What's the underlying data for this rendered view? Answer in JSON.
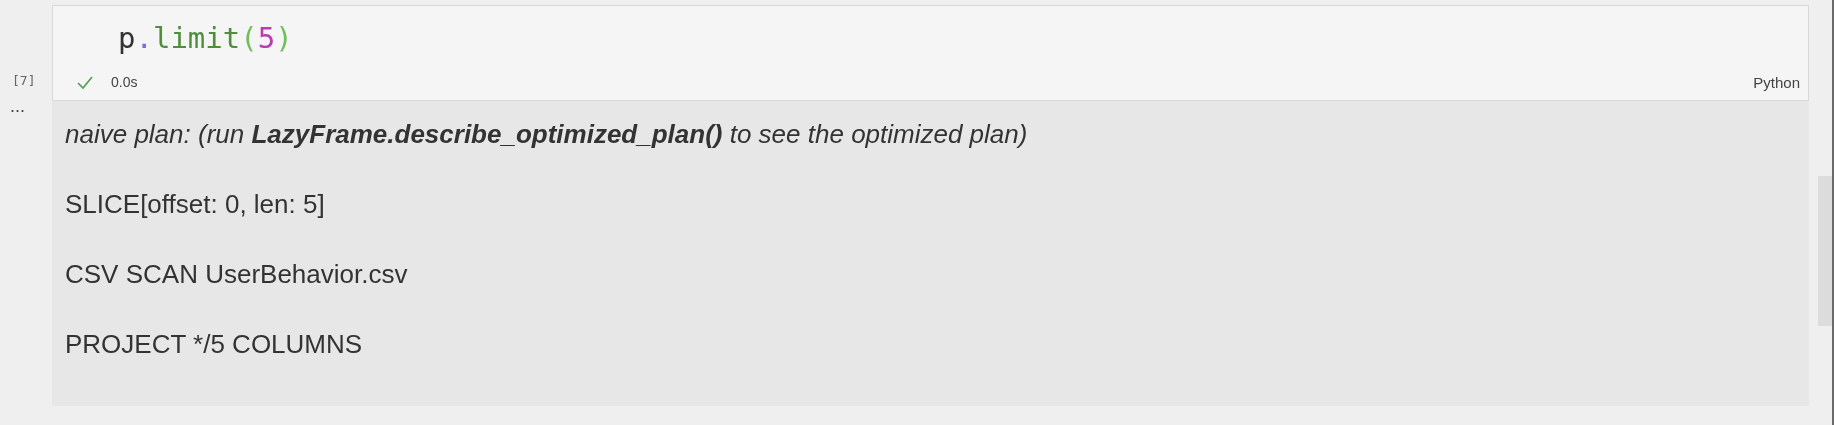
{
  "cell": {
    "execution_count": "[7]",
    "code_tokens": [
      {
        "text": "p",
        "kind": "name"
      },
      {
        "text": ".",
        "kind": "punct"
      },
      {
        "text": "limit",
        "kind": "func"
      },
      {
        "text": "(",
        "kind": "bracket"
      },
      {
        "text": "5",
        "kind": "number"
      },
      {
        "text": ")",
        "kind": "bracket"
      }
    ],
    "succeeded": true,
    "duration": "0.0s",
    "language": "Python"
  },
  "output": {
    "more_label": "...",
    "lines": [
      {
        "text": "naive plan: (run **LazyFrame.describe_optimized_plan()** to see the optimized plan)",
        "kind": "italic"
      },
      {
        "text": "SLICE[offset: 0, len: 5]",
        "kind": "plain"
      },
      {
        "text": "CSV SCAN UserBehavior.csv",
        "kind": "plain"
      },
      {
        "text": "PROJECT */5 COLUMNS",
        "kind": "plain"
      }
    ]
  }
}
